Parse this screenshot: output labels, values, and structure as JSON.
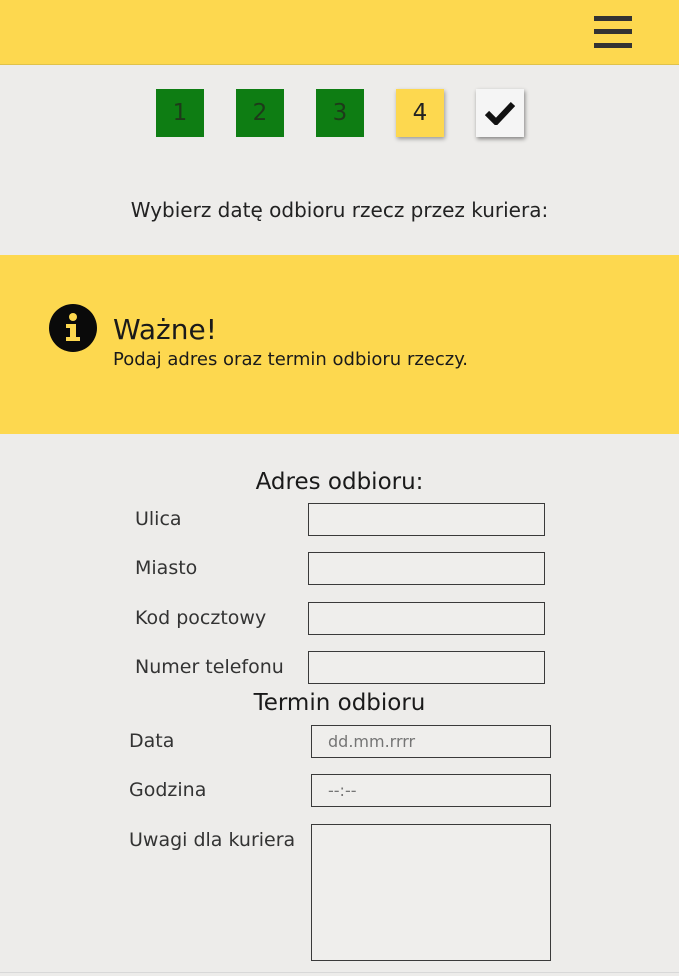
{
  "header": {
    "menu_icon": "hamburger-menu-icon"
  },
  "steps": [
    {
      "label": "1",
      "status": "done"
    },
    {
      "label": "2",
      "status": "done"
    },
    {
      "label": "3",
      "status": "done"
    },
    {
      "label": "4",
      "status": "current"
    },
    {
      "label": "",
      "status": "final",
      "icon": "checkmark-icon"
    }
  ],
  "instruction": "Wybierz datę odbioru rzecz przez kuriera:",
  "notice": {
    "icon": "info-icon",
    "title": "Ważne!",
    "text": "Podaj adres oraz termin odbioru rzeczy."
  },
  "address": {
    "title": "Adres odbioru:",
    "street_label": "Ulica",
    "street_value": "",
    "city_label": "Miasto",
    "city_value": "",
    "postal_label": "Kod pocztowy",
    "postal_value": "",
    "phone_label": "Numer telefonu",
    "phone_value": ""
  },
  "schedule": {
    "title": "Termin odbioru",
    "date_label": "Data",
    "date_placeholder": "dd.mm.rrrr",
    "time_label": "Godzina",
    "time_placeholder": "--:--",
    "notes_label": "Uwagi dla kuriera",
    "notes_value": ""
  },
  "colors": {
    "accent": "#fdd84f",
    "done_step": "#0e7d13",
    "background": "#edecea"
  }
}
